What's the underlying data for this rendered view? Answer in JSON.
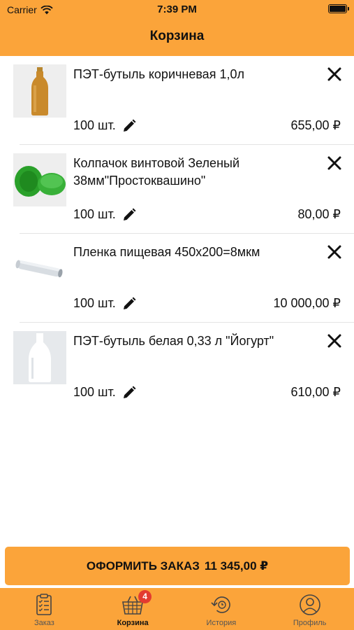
{
  "status_bar": {
    "carrier": "Carrier",
    "time": "7:39 PM"
  },
  "header": {
    "title": "Корзина"
  },
  "cart": {
    "items": [
      {
        "name": "ПЭТ-бутыль коричневая 1,0л",
        "quantity": "100 шт.",
        "price": "655,00 ₽",
        "image_icon": "brown-bottle-image"
      },
      {
        "name": "Колпачок винтовой Зеленый 38мм\"Простоквашино\"",
        "quantity": "100 шт.",
        "price": "80,00 ₽",
        "image_icon": "green-caps-image"
      },
      {
        "name": "Пленка пищевая 450х200=8мкм",
        "quantity": "100 шт.",
        "price": "10 000,00 ₽",
        "image_icon": "film-roll-image"
      },
      {
        "name": "ПЭТ-бутыль белая 0,33 л \"Йогурт\"",
        "quantity": "100 шт.",
        "price": "610,00 ₽",
        "image_icon": "white-bottle-image"
      }
    ]
  },
  "checkout": {
    "label": "ОФОРМИТЬ ЗАКАЗ",
    "total": "11 345,00 ₽"
  },
  "tabbar": {
    "tabs": [
      {
        "label": "Заказ",
        "icon": "clipboard-list-icon"
      },
      {
        "label": "Корзина",
        "icon": "basket-icon",
        "badge": "4",
        "active": true
      },
      {
        "label": "История",
        "icon": "history-icon"
      },
      {
        "label": "Профиль",
        "icon": "profile-icon"
      }
    ]
  },
  "colors": {
    "accent": "#fba43a",
    "badge": "#e33b30",
    "divider": "#e4e4e4"
  }
}
